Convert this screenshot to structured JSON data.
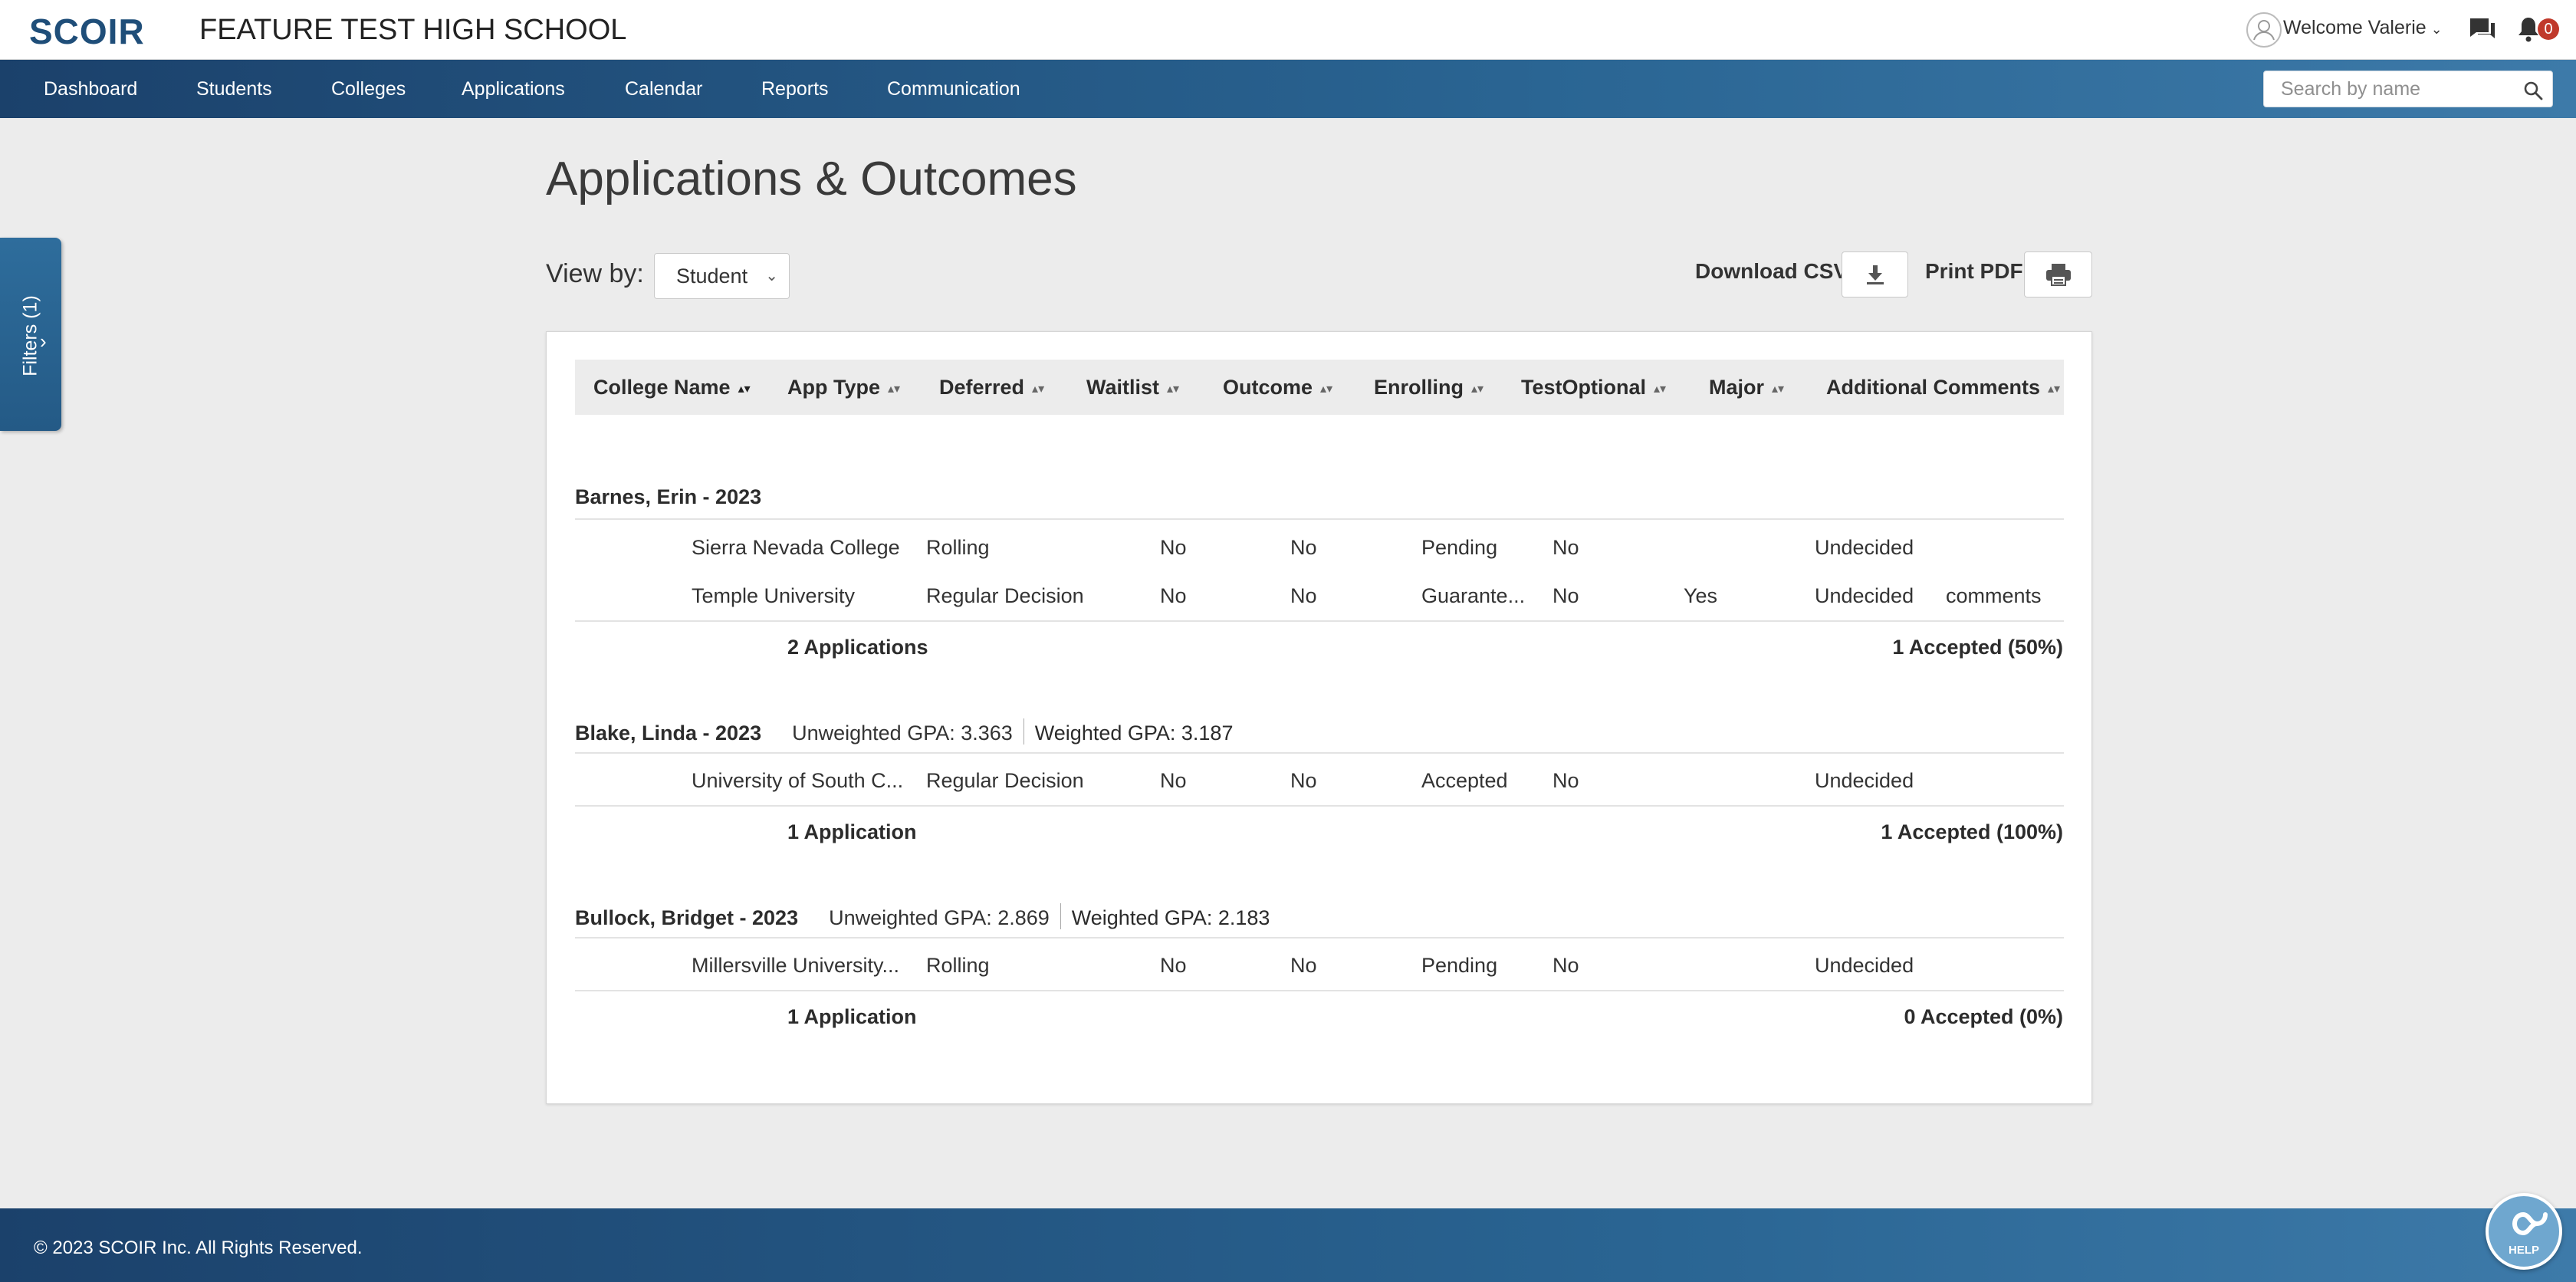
{
  "header": {
    "logo": "SCOIR",
    "school_name": "FEATURE TEST HIGH SCHOOL",
    "welcome": "Welcome Valerie",
    "notification_count": "0"
  },
  "nav": {
    "items": [
      "Dashboard",
      "Students",
      "Colleges",
      "Applications",
      "Calendar",
      "Reports",
      "Communication"
    ],
    "search_placeholder": "Search by name"
  },
  "filters_tab": "Filters (1)",
  "page": {
    "title": "Applications & Outcomes",
    "view_by_label": "View by:",
    "view_by_value": "Student",
    "download_label": "Download CSV",
    "print_label": "Print PDF"
  },
  "table": {
    "columns": [
      "College Name",
      "App Type",
      "Deferred",
      "Waitlist",
      "Outcome",
      "Enrolling",
      "TestOptional",
      "Major",
      "Additional Comments"
    ],
    "groups": [
      {
        "student": "Barnes, Erin - 2023",
        "unweighted_gpa": "",
        "weighted_gpa": "",
        "rows": [
          {
            "college": "Sierra Nevada College",
            "app_type": "Rolling",
            "deferred": "No",
            "waitlist": "No",
            "outcome": "Pending",
            "enrolling": "No",
            "test_optional": "",
            "major": "Undecided",
            "comments": ""
          },
          {
            "college": "Temple University",
            "app_type": "Regular Decision",
            "deferred": "No",
            "waitlist": "No",
            "outcome": "Guarante...",
            "enrolling": "No",
            "test_optional": "Yes",
            "major": "Undecided",
            "comments": "comments"
          }
        ],
        "app_count": "2 Applications",
        "accepted": "1 Accepted (50%)"
      },
      {
        "student": "Blake, Linda - 2023",
        "unweighted_gpa": "Unweighted GPA: 3.363",
        "weighted_gpa": "Weighted GPA: 3.187",
        "rows": [
          {
            "college": "University of South C...",
            "app_type": "Regular Decision",
            "deferred": "No",
            "waitlist": "No",
            "outcome": "Accepted",
            "enrolling": "No",
            "test_optional": "",
            "major": "Undecided",
            "comments": ""
          }
        ],
        "app_count": "1 Application",
        "accepted": "1 Accepted (100%)"
      },
      {
        "student": "Bullock, Bridget - 2023",
        "unweighted_gpa": "Unweighted GPA: 2.869",
        "weighted_gpa": "Weighted GPA: 2.183",
        "rows": [
          {
            "college": "Millersville University...",
            "app_type": "Rolling",
            "deferred": "No",
            "waitlist": "No",
            "outcome": "Pending",
            "enrolling": "No",
            "test_optional": "",
            "major": "Undecided",
            "comments": ""
          }
        ],
        "app_count": "1 Application",
        "accepted": "0 Accepted (0%)"
      }
    ]
  },
  "footer": {
    "copyright": "© 2023 SCOIR Inc. All Rights Reserved.",
    "help_label": "HELP"
  },
  "colors": {
    "nav_start": "#1b416b",
    "nav_end": "#3d7aa9",
    "brand": "#1f4e79",
    "badge": "#c0392b"
  }
}
